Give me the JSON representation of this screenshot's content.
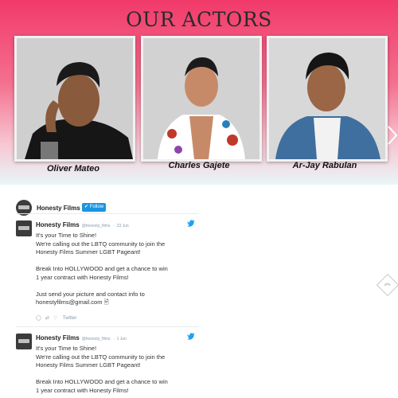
{
  "hero": {
    "title": "OUR ACTORS",
    "actors": [
      {
        "name": "Oliver Mateo"
      },
      {
        "name": "Charles Gajete"
      },
      {
        "name": "Ar-Jay Rabulan"
      }
    ],
    "next_icon": "chevron-right-icon"
  },
  "feed": {
    "account_name": "Honesty Films",
    "follow_label": "Follow",
    "tweets": [
      {
        "name": "Honesty Films",
        "handle": "@honesty_films",
        "date": "· 23 Jun",
        "lines": [
          "It's your Time to Shine!",
          "We're calling out the LBTQ community to join the",
          "Honesty Films Summer LGBT Pageant!",
          "",
          "Break Into HOLLYWOOD and get a chance to win",
          "1 year contract with Honesty Films!",
          "",
          "Just send your picture and contact info to",
          "honestyfilms@gmail.com"
        ],
        "actions_label": "Twitter"
      },
      {
        "name": "Honesty Films",
        "handle": "@honesty_films",
        "date": "· 1 Jun",
        "lines": [
          "It's your Time to Shine!",
          "We're calling out the LBTQ community to join the",
          "Honesty Films Summer LGBT Pageant!",
          "",
          "Break Into HOLLYWOOD and get a chance to win",
          "1 year contract with Honesty Films!"
        ]
      }
    ]
  },
  "colors": {
    "hero_top": "#f13a6a",
    "hero_bottom": "#e8f6f8",
    "twitter_blue": "#1b95e0"
  },
  "scroll_top_icon": "double-chevron-up-icon"
}
